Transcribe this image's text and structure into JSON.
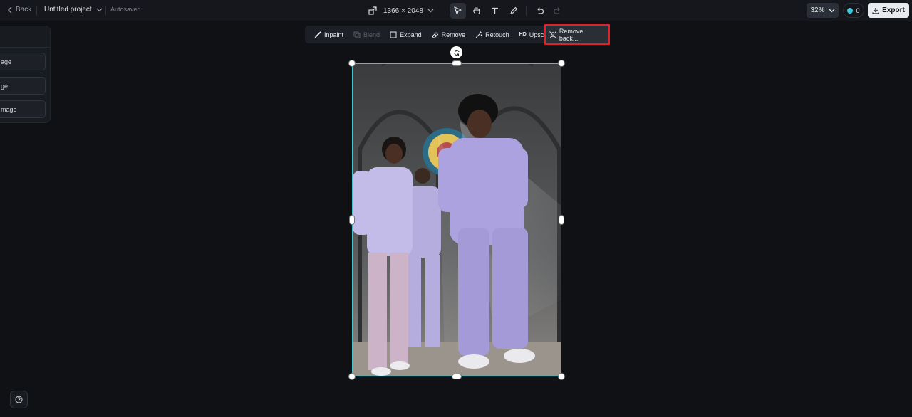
{
  "topbar": {
    "back_label": "Back",
    "project_name": "Untitled project",
    "autosave_status": "Autosaved",
    "dimensions": "1366 × 2048",
    "zoom": "32%",
    "credits": "0",
    "export_label": "Export"
  },
  "side_panel": {
    "items": [
      {
        "label": "age"
      },
      {
        "label": "ge"
      },
      {
        "label": "mage"
      }
    ]
  },
  "edit_toolbar": {
    "items": [
      {
        "label": "Inpaint",
        "icon": "brush-icon"
      },
      {
        "label": "Blend",
        "icon": "blend-icon",
        "disabled": true
      },
      {
        "label": "Expand",
        "icon": "expand-icon"
      },
      {
        "label": "Remove",
        "icon": "eraser-icon"
      },
      {
        "label": "Retouch",
        "icon": "magic-wand-icon"
      },
      {
        "label": "Upscale",
        "icon": "hd-icon",
        "icon_text": "HD"
      },
      {
        "label": "Remove back...",
        "icon": "remove-background-icon"
      }
    ]
  },
  "colors": {
    "selection": "#39c9cf",
    "highlight": "#e0202a",
    "background": "#0f1115"
  }
}
